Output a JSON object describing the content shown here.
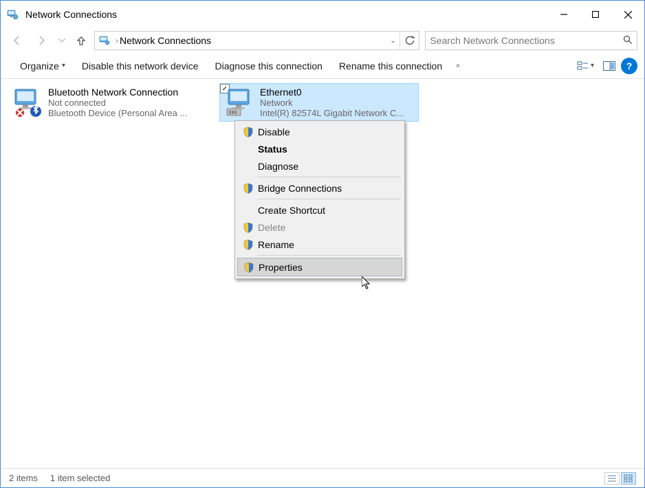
{
  "window": {
    "title": "Network Connections"
  },
  "addressbar": {
    "path": "Network Connections"
  },
  "search": {
    "placeholder": "Search Network Connections"
  },
  "toolbar": {
    "organize": "Organize",
    "disable_device": "Disable this network device",
    "diagnose": "Diagnose this connection",
    "rename": "Rename this connection"
  },
  "items": [
    {
      "name": "Bluetooth Network Connection",
      "status": "Not connected",
      "device": "Bluetooth Device (Personal Area ...",
      "selected": false,
      "error": true,
      "badge": "bluetooth"
    },
    {
      "name": "Ethernet0",
      "status": "Network",
      "device": "Intel(R) 82574L Gigabit Network C...",
      "selected": true,
      "error": false
    }
  ],
  "context_menu": {
    "items": [
      {
        "label": "Disable",
        "shield": true
      },
      {
        "label": "Status",
        "bold": true
      },
      {
        "label": "Diagnose"
      },
      {
        "separator": true
      },
      {
        "label": "Bridge Connections",
        "shield": true
      },
      {
        "separator": true
      },
      {
        "label": "Create Shortcut"
      },
      {
        "label": "Delete",
        "shield": true,
        "disabled": true
      },
      {
        "label": "Rename",
        "shield": true
      },
      {
        "separator": true
      },
      {
        "label": "Properties",
        "shield": true,
        "hover": true
      }
    ]
  },
  "statusbar": {
    "count": "2 items",
    "selected": "1 item selected"
  }
}
